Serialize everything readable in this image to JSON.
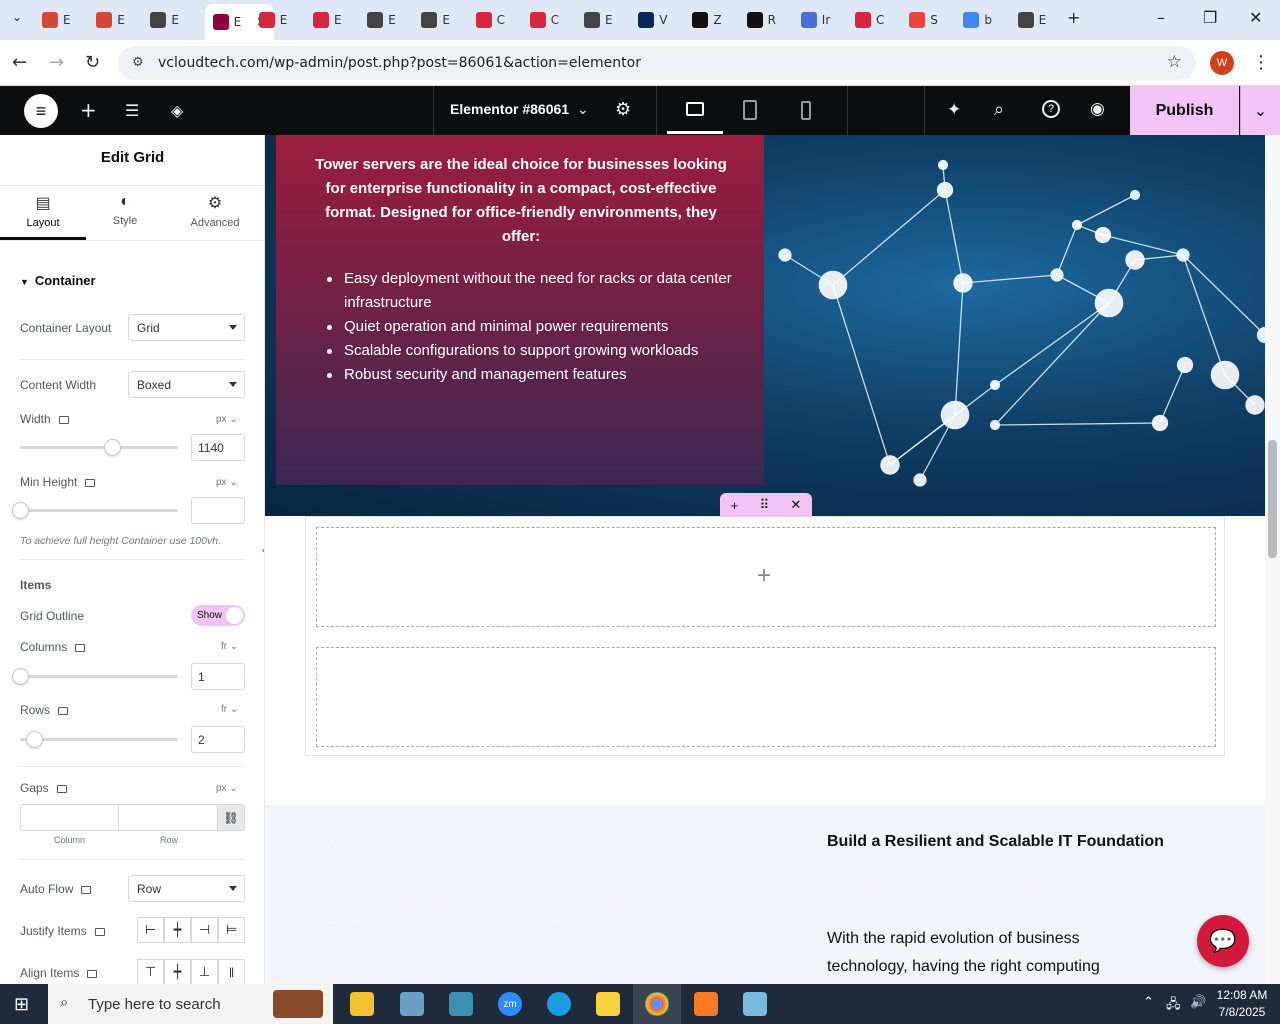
{
  "browser": {
    "tabs": [
      {
        "label": "E",
        "color": "#d6483a"
      },
      {
        "label": "E",
        "color": "#d6483a"
      },
      {
        "label": "E",
        "color": "#444"
      },
      {
        "label": "E",
        "color": "#92003b",
        "active": true
      },
      {
        "label": "E",
        "color": "#d6273e"
      },
      {
        "label": "E",
        "color": "#d6273e"
      },
      {
        "label": "E",
        "color": "#444"
      },
      {
        "label": "E",
        "color": "#444"
      },
      {
        "label": "C",
        "color": "#d6273e"
      },
      {
        "label": "C",
        "color": "#d6273e"
      },
      {
        "label": "E",
        "color": "#444"
      },
      {
        "label": "V",
        "color": "#0a2b55"
      },
      {
        "label": "Z",
        "color": "#111"
      },
      {
        "label": "R",
        "color": "#111"
      },
      {
        "label": "Ir",
        "color": "#4a6fd9"
      },
      {
        "label": "C",
        "color": "#d6273e"
      },
      {
        "label": "S",
        "color": "#e8453c"
      },
      {
        "label": "b",
        "color": "#4285f4"
      },
      {
        "label": "E",
        "color": "#444"
      }
    ],
    "url": "vcloudtech.com/wp-admin/post.php?post=86061&action=elementor",
    "profile_initial": "W"
  },
  "topbar": {
    "doc_title": "Elementor #86061",
    "publish_label": "Publish"
  },
  "panel": {
    "title": "Edit Grid",
    "tabs": [
      "Layout",
      "Style",
      "Advanced"
    ],
    "section": "Container",
    "container_layout": {
      "label": "Container Layout",
      "value": "Grid"
    },
    "content_width": {
      "label": "Content Width",
      "value": "Boxed"
    },
    "width": {
      "label": "Width",
      "unit": "px",
      "value": "1140",
      "level": 0.58
    },
    "min_height": {
      "label": "Min Height",
      "unit": "px",
      "value": "",
      "level": 0
    },
    "hint": "To achieve full height Container use 100vh.",
    "items_heading": "Items",
    "grid_outline": {
      "label": "Grid Outline",
      "toggle": "Show"
    },
    "columns": {
      "label": "Columns",
      "unit": "fr",
      "value": "1",
      "level": 0
    },
    "rows": {
      "label": "Rows",
      "unit": "fr",
      "value": "2",
      "level": 0.09
    },
    "gaps": {
      "label": "Gaps",
      "unit": "px",
      "col_label": "Column",
      "row_label": "Row"
    },
    "auto_flow": {
      "label": "Auto Flow",
      "value": "Row"
    },
    "justify_items": {
      "label": "Justify Items"
    },
    "align_items": {
      "label": "Align Items"
    }
  },
  "canvas": {
    "hero_lead": "Tower servers are the ideal choice for businesses looking for enterprise functionality in a compact, cost-effective format. Designed for office-friendly environments, they offer:",
    "hero_items": [
      "Easy deployment without the need for racks or data center infrastructure",
      "Quiet operation and minimal power requirements",
      "Scalable configurations to support growing workloads",
      "Robust security and management features"
    ],
    "ghost_text": "With the rapid evolution of business technology, having the right computing infrastructure is essential for agility and innovation. vCloud Tech's comprehensive suite of server solutions ensures you have the",
    "lower_heading": "Build a Resilient and Scalable IT Foundation",
    "lower_heading_ghost": "Build a Resilient and Scalable IT Foundation",
    "lower_para": "With the rapid evolution of business technology, having the right computing"
  },
  "taskbar": {
    "search_placeholder": "Type here to search",
    "time": "12:08 AM",
    "date": "7/8/2025"
  }
}
